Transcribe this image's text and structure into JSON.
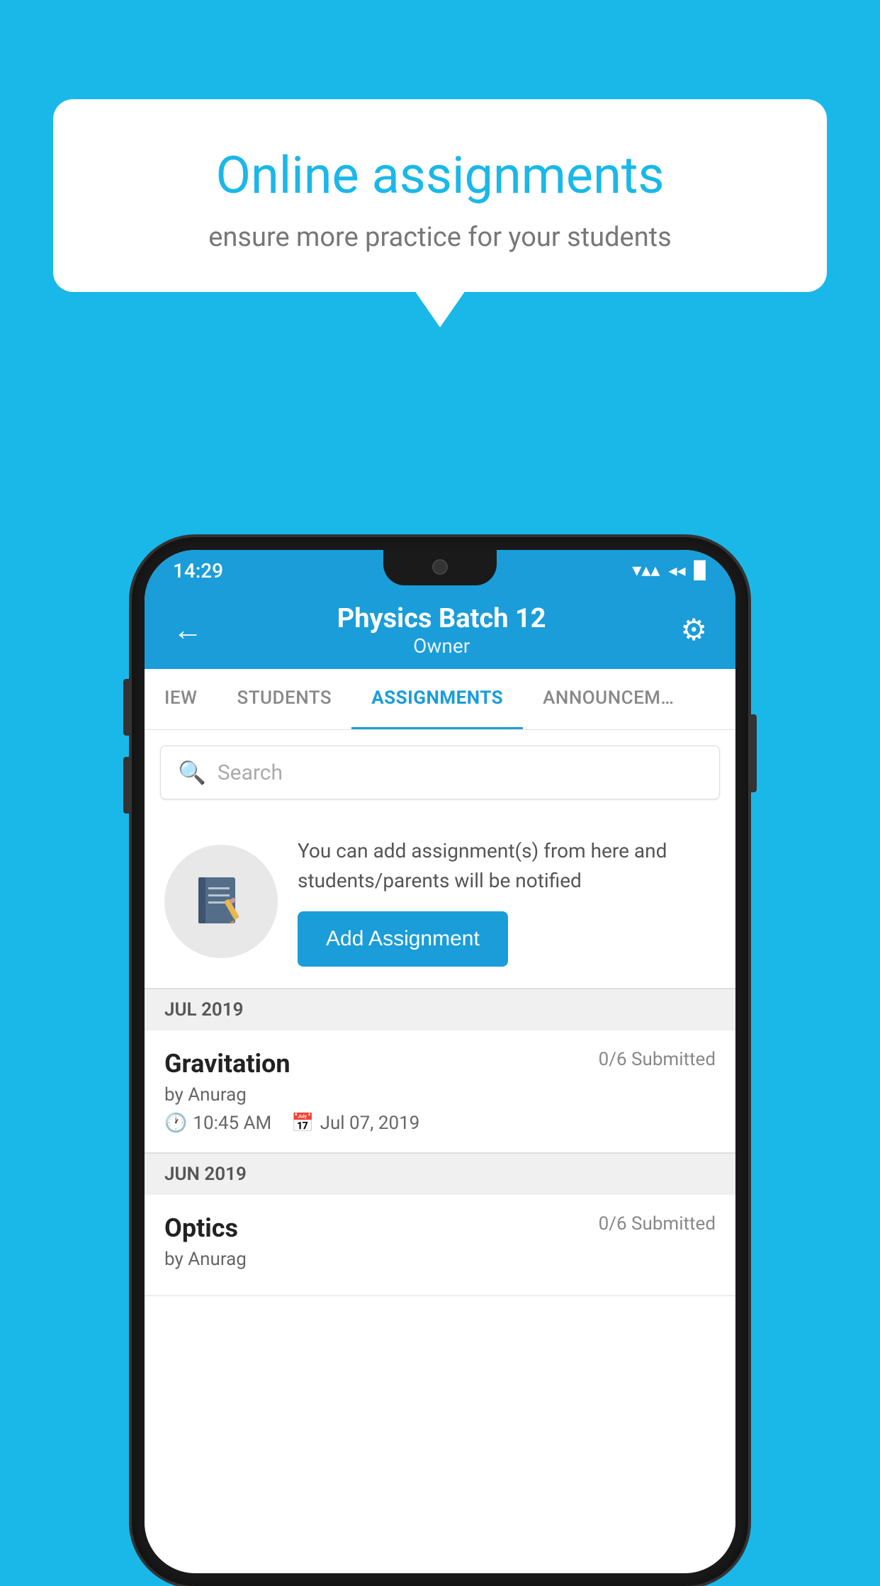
{
  "background_color": "#1ab8e8",
  "speech_bubble": {
    "title": "Online assignments",
    "subtitle": "ensure more practice for your students"
  },
  "status_bar": {
    "time": "14:29",
    "wifi": "▾",
    "signal": "▲",
    "battery": "▉"
  },
  "header": {
    "title": "Physics Batch 12",
    "subtitle": "Owner",
    "back_label": "←",
    "settings_label": "⚙"
  },
  "tabs": [
    {
      "label": "IEW",
      "active": false
    },
    {
      "label": "STUDENTS",
      "active": false
    },
    {
      "label": "ASSIGNMENTS",
      "active": true
    },
    {
      "label": "ANNOUNCEM…",
      "active": false
    }
  ],
  "search": {
    "placeholder": "Search"
  },
  "promo": {
    "text": "You can add assignment(s) from here and students/parents will be notified",
    "button_label": "Add Assignment"
  },
  "sections": [
    {
      "label": "JUL 2019",
      "assignments": [
        {
          "title": "Gravitation",
          "submitted": "0/6 Submitted",
          "author": "by Anurag",
          "time": "10:45 AM",
          "date": "Jul 07, 2019"
        }
      ]
    },
    {
      "label": "JUN 2019",
      "assignments": [
        {
          "title": "Optics",
          "submitted": "0/6 Submitted",
          "author": "by Anurag",
          "time": "",
          "date": ""
        }
      ]
    }
  ]
}
